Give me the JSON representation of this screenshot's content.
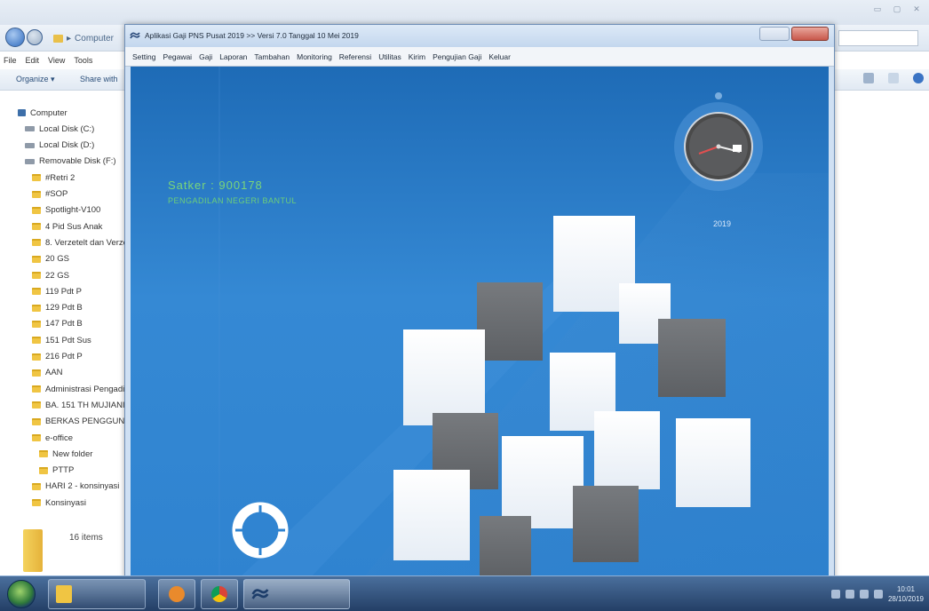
{
  "explorer": {
    "breadcrumb": "Computer",
    "menu": [
      "File",
      "Edit",
      "View",
      "Tools"
    ],
    "toolbar": {
      "organize": "Organize ▾",
      "share": "Share with"
    },
    "window_controls": [
      "▭",
      "▢",
      "✕"
    ],
    "tree": [
      {
        "label": "Computer",
        "icon": "computer-icon",
        "indent": 0
      },
      {
        "label": "Local Disk (C:)",
        "icon": "disk-icon",
        "indent": 1
      },
      {
        "label": "Local Disk (D:)",
        "icon": "disk-icon",
        "indent": 1
      },
      {
        "label": "Removable Disk (F:)",
        "icon": "disk-icon",
        "indent": 1
      },
      {
        "label": "#Retri 2",
        "icon": "folder-icon",
        "indent": 2
      },
      {
        "label": "#SOP",
        "icon": "folder-icon",
        "indent": 2
      },
      {
        "label": "Spotlight-V100",
        "icon": "folder-icon",
        "indent": 2
      },
      {
        "label": "4 Pid Sus Anak",
        "icon": "folder-icon",
        "indent": 2
      },
      {
        "label": "8. Verzetelt dan Verze",
        "icon": "folder-icon",
        "indent": 2
      },
      {
        "label": "20 GS",
        "icon": "folder-icon",
        "indent": 2
      },
      {
        "label": "22 GS",
        "icon": "folder-icon",
        "indent": 2
      },
      {
        "label": "119 Pdt P",
        "icon": "folder-icon",
        "indent": 2
      },
      {
        "label": "129 Pdt B",
        "icon": "folder-icon",
        "indent": 2
      },
      {
        "label": "147 Pdt B",
        "icon": "folder-icon",
        "indent": 2
      },
      {
        "label": "151 Pdt Sus",
        "icon": "folder-icon",
        "indent": 2
      },
      {
        "label": "216 Pdt P",
        "icon": "folder-icon",
        "indent": 2
      },
      {
        "label": "AAN",
        "icon": "folder-icon",
        "indent": 2
      },
      {
        "label": "Administrasi Pengadil",
        "icon": "folder-icon",
        "indent": 2
      },
      {
        "label": "BA. 151 TH MUJIANI",
        "icon": "folder-icon",
        "indent": 2
      },
      {
        "label": "BERKAS PENGGUNAA",
        "icon": "folder-icon",
        "indent": 2
      },
      {
        "label": "e-office",
        "icon": "folder-icon",
        "indent": 2
      },
      {
        "label": "New folder",
        "icon": "folder-icon",
        "indent": 3
      },
      {
        "label": "PTTP",
        "icon": "folder-icon",
        "indent": 3
      },
      {
        "label": "HARI 2 - konsinyasi",
        "icon": "folder-icon",
        "indent": 2
      },
      {
        "label": "Konsinyasi",
        "icon": "folder-icon",
        "indent": 2
      }
    ],
    "status": "16 items"
  },
  "app": {
    "title": "Aplikasi Gaji PNS Pusat 2019 >> Versi 7.0 Tanggal 10 Mei 2019",
    "menu": [
      "Setting",
      "Pegawai",
      "Gaji",
      "Laporan",
      "Tambahan",
      "Monitoring",
      "Referensi",
      "Utilitas",
      "Kirim",
      "Pengujian Gaji",
      "Keluar"
    ],
    "satker_label": "Satker : 900178",
    "agency_label": "PENGADILAN NEGERI BANTUL",
    "clock_year": "2019",
    "colors": {
      "background_top": "#1e6bb6",
      "background_bottom": "#2f83d0",
      "accent_green": "#7ad57a"
    }
  },
  "taskbar": {
    "start": "start-orb",
    "tray_time": "10:01",
    "tray_date": "28/10/2019"
  }
}
